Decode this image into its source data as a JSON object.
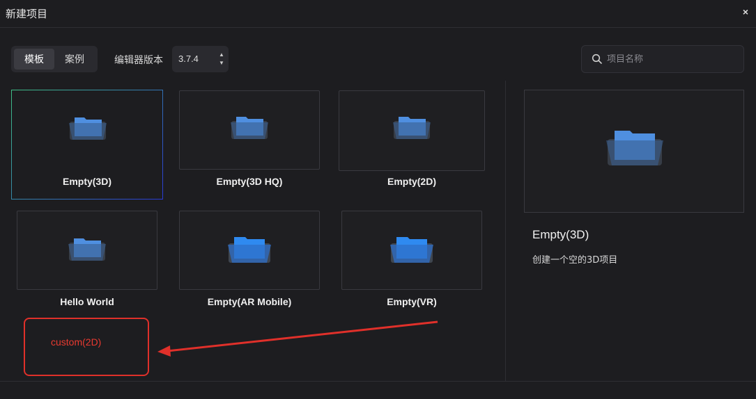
{
  "window": {
    "title": "新建项目",
    "close_glyph": "×"
  },
  "tabs": [
    {
      "label": "模板",
      "active": true
    },
    {
      "label": "案例",
      "active": false
    }
  ],
  "version": {
    "label": "编辑器版本",
    "value": "3.7.4"
  },
  "search": {
    "placeholder": "项目名称",
    "value": ""
  },
  "templates": [
    {
      "label": "Empty(3D)",
      "selected": true,
      "icon": "folder-icon"
    },
    {
      "label": "Empty(3D HQ)",
      "selected": false,
      "icon": "folder-icon"
    },
    {
      "label": "Empty(2D)",
      "selected": false,
      "icon": "folder-icon"
    },
    {
      "label": "Hello World",
      "selected": false,
      "icon": "folder-icon"
    },
    {
      "label": "Empty(AR Mobile)",
      "selected": false,
      "icon": "folder-icon"
    },
    {
      "label": "Empty(VR)",
      "selected": false,
      "icon": "folder-icon"
    }
  ],
  "preview": {
    "title": "Empty(3D)",
    "description": "创建一个空的3D项目"
  },
  "annotation": {
    "text": "custom(2D)",
    "color": "#e0302a"
  },
  "colors": {
    "folder_blue": "#4f8fe0",
    "folder_bright": "#2f8af0",
    "selected_border_start": "#3fbf86",
    "selected_border_end": "#2a3ad6"
  }
}
